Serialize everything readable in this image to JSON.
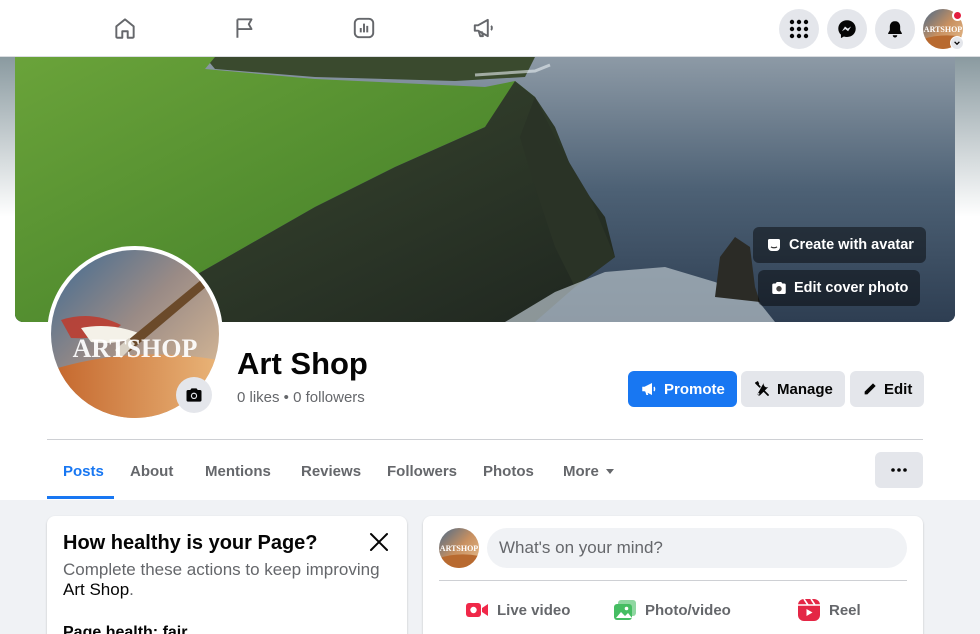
{
  "topnav": {
    "icons": [
      "home-icon",
      "flag-icon",
      "insights-icon",
      "megaphone-icon"
    ],
    "right": [
      "menu-grid-icon",
      "messenger-icon",
      "bell-icon"
    ],
    "profile_thumb_text": "ARTSHOP"
  },
  "cover": {
    "create_avatar_label": "Create with avatar",
    "edit_cover_label": "Edit cover photo"
  },
  "profile": {
    "avatar_text": "ARTSHOP",
    "name": "Art Shop",
    "stats": "0 likes • 0 followers"
  },
  "actions": {
    "promote": "Promote",
    "manage": "Manage",
    "edit": "Edit"
  },
  "tabs": [
    {
      "label": "Posts"
    },
    {
      "label": "About"
    },
    {
      "label": "Mentions"
    },
    {
      "label": "Reviews"
    },
    {
      "label": "Followers"
    },
    {
      "label": "Photos"
    },
    {
      "label": "More"
    }
  ],
  "health": {
    "title": "How healthy is your Page?",
    "desc_prefix": "Complete these actions to keep improving ",
    "desc_name": "Art Shop",
    "desc_suffix": ".",
    "status": "Page health: fair"
  },
  "composer": {
    "avatar_text": "ARTSHOP",
    "placeholder": "What's on your mind?",
    "live_video": "Live video",
    "photo_video": "Photo/video",
    "reel": "Reel"
  },
  "colors": {
    "accent": "#1877f2",
    "live": "#f02849",
    "photo": "#45bd62",
    "reel": "#e42645"
  }
}
